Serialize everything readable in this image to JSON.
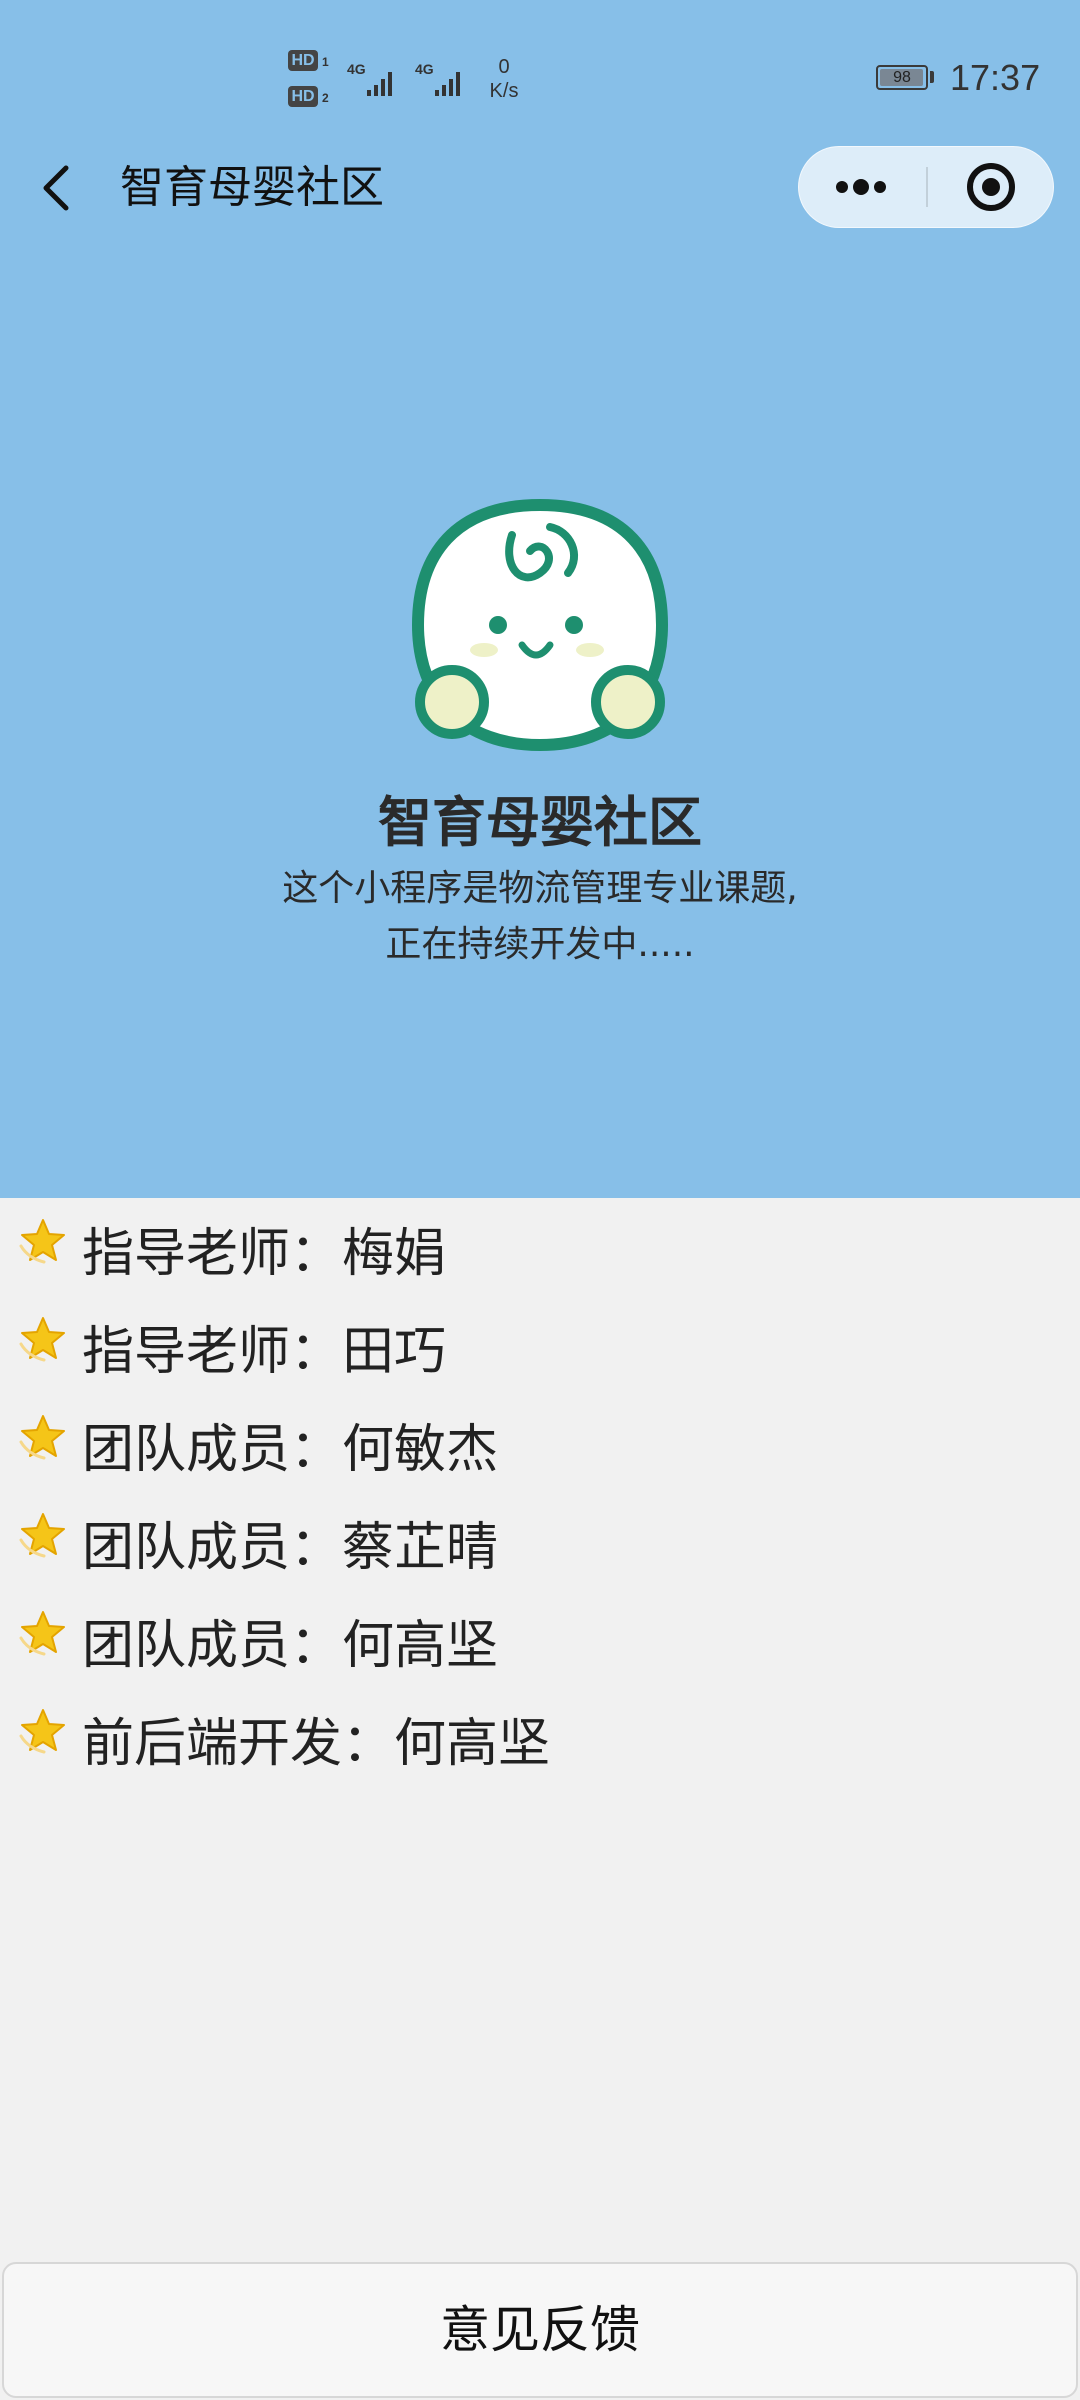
{
  "status_bar": {
    "hd1": "HD",
    "hd1_sub": "1",
    "hd2": "HD",
    "hd2_sub": "2",
    "signal_1_label": "4G",
    "signal_2_label": "4G",
    "net_speed_value": "0",
    "net_speed_unit": "K/s",
    "battery_level": "98",
    "time": "17:37"
  },
  "nav": {
    "title": "智育母婴社区"
  },
  "hero": {
    "title": "智育母婴社区",
    "desc_line1": "这个小程序是物流管理专业课题,",
    "desc_line2": "正在持续开发中....."
  },
  "members": [
    {
      "text": "指导老师：梅娟"
    },
    {
      "text": "指导老师：田巧"
    },
    {
      "text": "团队成员：何敏杰"
    },
    {
      "text": "团队成员：蔡芷晴"
    },
    {
      "text": "团队成员：何高坚"
    },
    {
      "text": "前后端开发：何高坚"
    }
  ],
  "feedback_button": "意见反馈",
  "colors": {
    "header_bg": "#87bfe8",
    "page_bg": "#f1f1f1",
    "logo_green": "#1e8f6f",
    "star_yellow": "#f5c518"
  }
}
